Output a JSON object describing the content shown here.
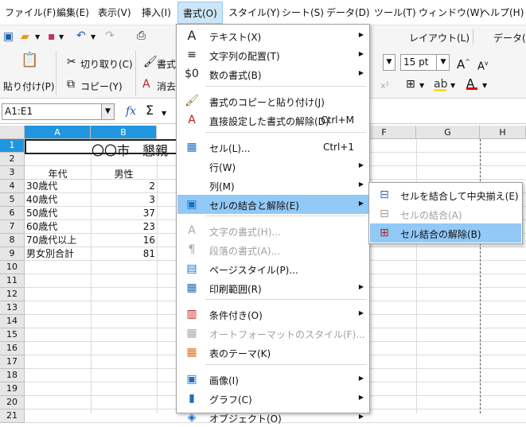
{
  "menubar": {
    "items": [
      "ファイル(F)",
      "編集(E)",
      "表示(V)",
      "挿入(I)",
      "書式(O)",
      "スタイル(Y)",
      "シート(S)",
      "データ(D)",
      "ツール(T)",
      "ウィンドウ(W)",
      "ヘルプ(H)"
    ]
  },
  "toolbar": {
    "tab_layout": "レイアウト(L)",
    "tab_data": "データ(D)",
    "cut": "切り取り(C)",
    "paste": "貼り付け(P)",
    "copy": "コピー(Y)",
    "format_partial": "書式",
    "clear_partial": "消去",
    "font_size": "15 pt"
  },
  "formula": {
    "name_box": "A1:E1",
    "fx": "fx",
    "sum": "Σ"
  },
  "sheet": {
    "columns": [
      "A",
      "B",
      "F",
      "G",
      "H"
    ],
    "rows": [
      "1",
      "2",
      "3",
      "4",
      "5",
      "6",
      "7",
      "8",
      "9",
      "10",
      "11",
      "12",
      "13",
      "14",
      "15",
      "16",
      "17",
      "18",
      "19",
      "20",
      "21"
    ],
    "title_partial": "〇〇市　懇親",
    "header_age": "年代",
    "header_male": "男性",
    "data": [
      {
        "age": "30歳代",
        "male": "2"
      },
      {
        "age": "40歳代",
        "male": "3"
      },
      {
        "age": "50歳代",
        "male": "37"
      },
      {
        "age": "60歳代",
        "male": "23"
      },
      {
        "age": "70歳代以上",
        "male": "16"
      },
      {
        "age": "男女別合計",
        "male": "81"
      }
    ]
  },
  "format_menu": {
    "items": [
      {
        "label": "テキスト(X)",
        "icon": "A",
        "arrow": true
      },
      {
        "label": "文字列の配置(T)",
        "icon": "≡",
        "arrow": true
      },
      {
        "label": "数の書式(B)",
        "icon": "$0",
        "arrow": true
      },
      {
        "label": "書式のコピーと貼り付け(J)",
        "icon": "🖌"
      },
      {
        "label": "直接設定した書式の解除(D)",
        "icon": "A",
        "shortcut": "Ctrl+M"
      },
      {
        "label": "セル(L)...",
        "icon": "▦",
        "shortcut": "Ctrl+1"
      },
      {
        "label": "行(W)",
        "arrow": true
      },
      {
        "label": "列(M)",
        "arrow": true
      },
      {
        "label": "セルの結合と解除(E)",
        "icon": "▣",
        "arrow": true
      },
      {
        "label": "文字の書式(H)...",
        "icon": "A"
      },
      {
        "label": "段落の書式(A)...",
        "icon": "¶"
      },
      {
        "label": "ページスタイル(P)...",
        "icon": "▤"
      },
      {
        "label": "印刷範囲(R)",
        "icon": "▦",
        "arrow": true
      },
      {
        "label": "条件付き(O)",
        "icon": "▥",
        "arrow": true
      },
      {
        "label": "オートフォーマットのスタイル(F)...",
        "icon": "▦"
      },
      {
        "label": "表のテーマ(K)",
        "icon": "▦"
      },
      {
        "label": "画像(I)",
        "icon": "▣",
        "arrow": true
      },
      {
        "label": "グラフ(C)",
        "icon": "▮",
        "arrow": true
      },
      {
        "label": "オブジェクト(O)",
        "icon": "◈",
        "arrow": true
      }
    ]
  },
  "merge_submenu": {
    "items": [
      {
        "label": "セルを結合して中央揃え(E)"
      },
      {
        "label": "セルの結合(A)"
      },
      {
        "label": "セル結合の解除(B)"
      }
    ]
  }
}
